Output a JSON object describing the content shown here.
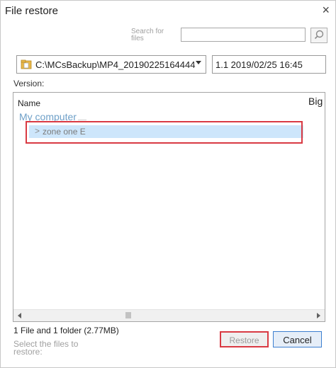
{
  "window": {
    "title": "File restore",
    "close_glyph": "×"
  },
  "search": {
    "label": "Search for files",
    "placeholder": "",
    "value": ""
  },
  "path_select": {
    "value": "C:\\MCsBackup\\MP4_20190225164444"
  },
  "version_label": "Version:",
  "version_select": {
    "value": "1.1  2019/02/25 16:45"
  },
  "tree": {
    "columns": {
      "name": "Name",
      "size_partial": "Big"
    },
    "root": "My computer",
    "child": {
      "chevron": ">",
      "label": "zone one E"
    }
  },
  "summary": "1 File and 1 folder (2.77MB)",
  "hint": "Select the files to restore:",
  "buttons": {
    "restore": "Restore",
    "cancel": "Cancel"
  },
  "colors": {
    "highlight": "#d93a43",
    "selection": "#cde6fb",
    "accent": "#3c7fd0"
  },
  "icons": {
    "search": "magnifier-icon",
    "folder": "folder-icon"
  }
}
